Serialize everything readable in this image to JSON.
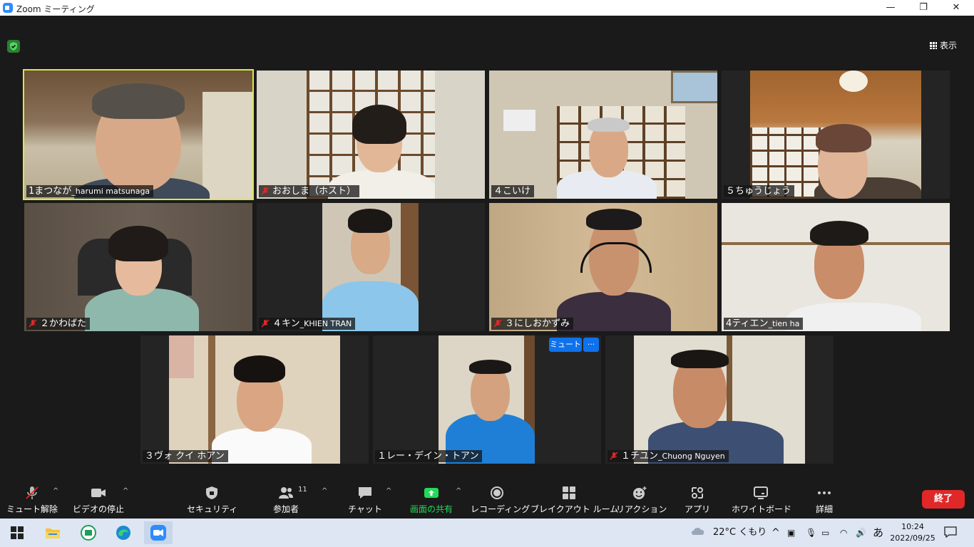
{
  "window": {
    "title": "Zoom ミーティング",
    "minimize": "—",
    "restore": "❐",
    "close": "✕"
  },
  "header": {
    "view_label": "表示"
  },
  "participants": [
    {
      "name": "1まつなが",
      "suffix": "_harumi matsunaga",
      "muted": false,
      "active": true
    },
    {
      "name": "おおしま（ホスト）",
      "suffix": "",
      "muted": true,
      "active": false
    },
    {
      "name": "４こいけ",
      "suffix": "",
      "muted": false,
      "active": false
    },
    {
      "name": "５ちゅうじょう",
      "suffix": "",
      "muted": false,
      "active": false
    },
    {
      "name": "２かわばた",
      "suffix": "",
      "muted": true,
      "active": false
    },
    {
      "name": "４キン",
      "suffix": "_KHIEN TRAN",
      "muted": true,
      "active": false
    },
    {
      "name": "３にしおかずみ",
      "suffix": "",
      "muted": true,
      "active": false
    },
    {
      "name": "4ティエン",
      "suffix": "_tien ha",
      "muted": false,
      "active": false
    },
    {
      "name": "３ヴォ クイ ホアン",
      "suffix": "",
      "muted": false,
      "active": false
    },
    {
      "name": "１レー・デイン・トアン",
      "suffix": "",
      "muted": false,
      "active": false
    },
    {
      "name": "１チユン",
      "suffix": "_Chuong Nguyen",
      "muted": true,
      "active": false
    }
  ],
  "tile_controls": {
    "mute_label": "ミュート",
    "more_label": "···"
  },
  "toolbar": {
    "unmute": "ミュート解除",
    "stop_video": "ビデオの停止",
    "security": "セキュリティ",
    "participants": "参加者",
    "participants_count": "11",
    "chat": "チャット",
    "share": "画面の共有",
    "record": "レコーディング",
    "breakout": "ブレイクアウト ルーム",
    "reactions": "リアクション",
    "apps": "アプリ",
    "whiteboard": "ホワイトボード",
    "more": "詳細",
    "end": "終了"
  },
  "taskbar": {
    "weather": "22°C くもり",
    "ime": "あ",
    "time": "10:24",
    "date": "2022/09/25"
  },
  "colors": {
    "accent": "#2D8CFF",
    "share_green": "#23d959",
    "end_red": "#e02828",
    "active_speaker": "#d8e84a"
  }
}
